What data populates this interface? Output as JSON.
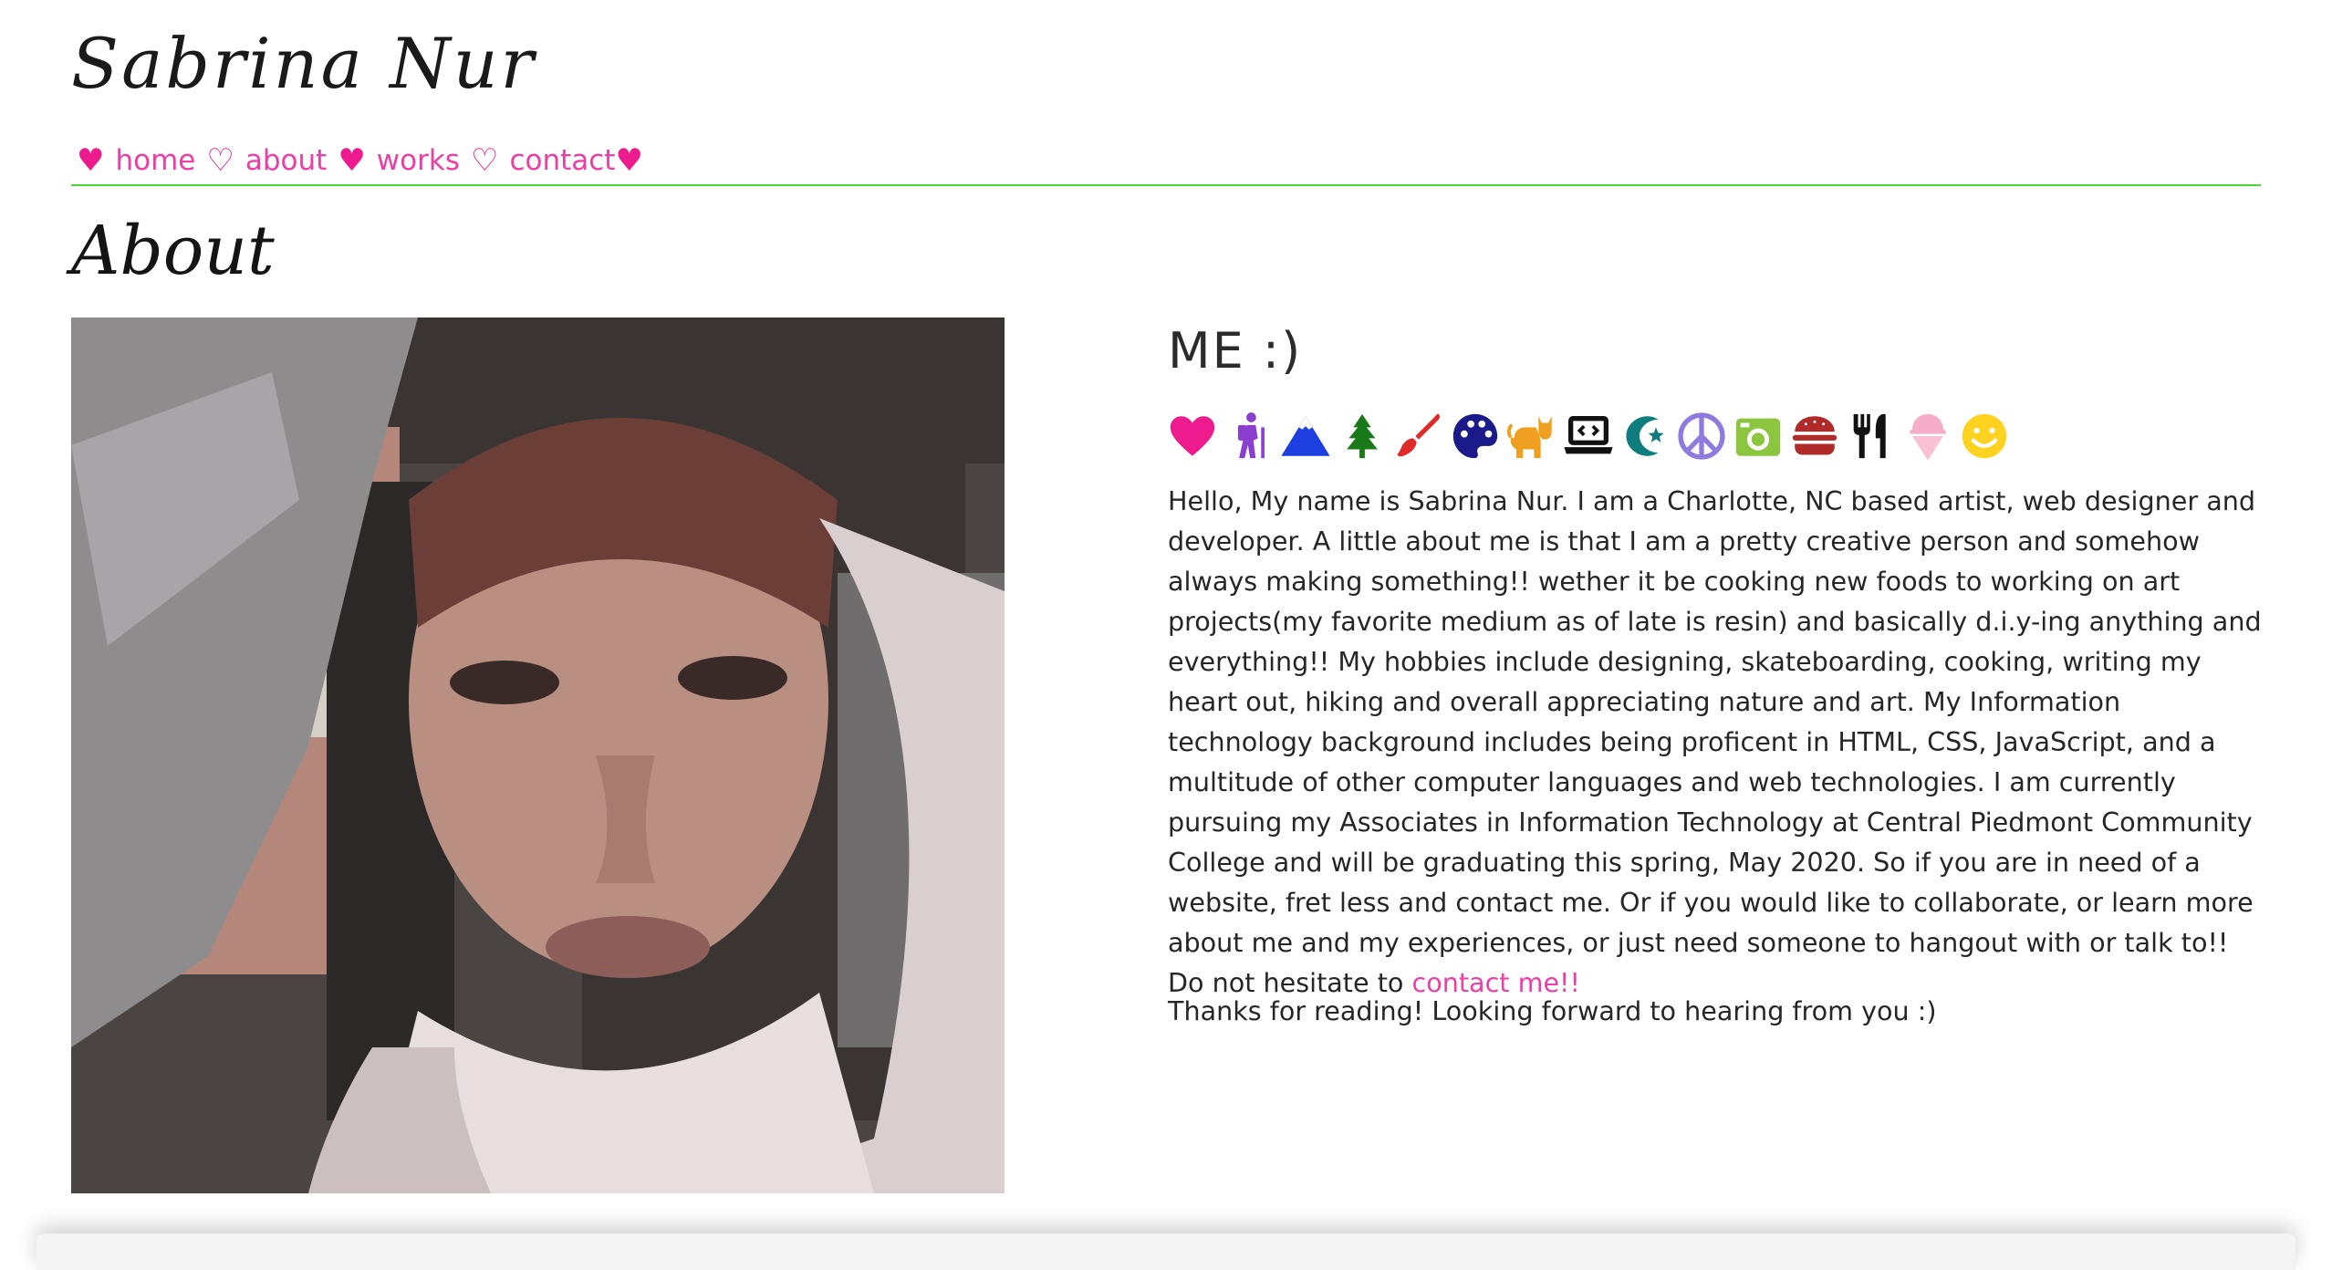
{
  "site": {
    "title": "Sabrina Nur"
  },
  "nav": {
    "items": [
      {
        "label": "home"
      },
      {
        "label": "about"
      },
      {
        "label": "works"
      },
      {
        "label": "contact"
      }
    ]
  },
  "section": {
    "title": "About"
  },
  "profile": {
    "heading": "ME :)",
    "icons": [
      "heart-icon",
      "hiker-icon",
      "mountain-icon",
      "tree-icon",
      "paintbrush-icon",
      "palette-icon",
      "cat-icon",
      "laptop-code-icon",
      "star-crescent-icon",
      "peace-icon",
      "camera-icon",
      "burger-icon",
      "utensils-icon",
      "ice-cream-icon",
      "smile-icon"
    ],
    "bio": "Hello, My name is Sabrina Nur. I am a Charlotte, NC based artist, web designer and developer. A little about me is that I am a pretty creative person and somehow always making something!! wether it be cooking new foods to working on art projects(my favorite medium as of late is resin) and basically d.i.y-ing anything and everything!! My hobbies include designing, skateboarding, cooking, writing my heart out, hiking and overall appreciating nature and art. My Information technology background includes being proficent in HTML, CSS, JavaScript, and a multitude of other computer languages and web technologies. I am currently pursuing my Associates in Information Technology at Central Piedmont Community College and will be graduating this spring, May 2020. So if you are in need of a website, fret less and contact me. Or if you would like to collaborate, or learn more about me and my experiences, or just need someone to hangout with or talk to!! Do not hesitate to",
    "bio_link": "contact me!!",
    "thanks": "Thanks for reading! Looking forward to hearing from you :)"
  },
  "colors": {
    "accent": "#ee3da6",
    "divider": "#4ed23b"
  }
}
